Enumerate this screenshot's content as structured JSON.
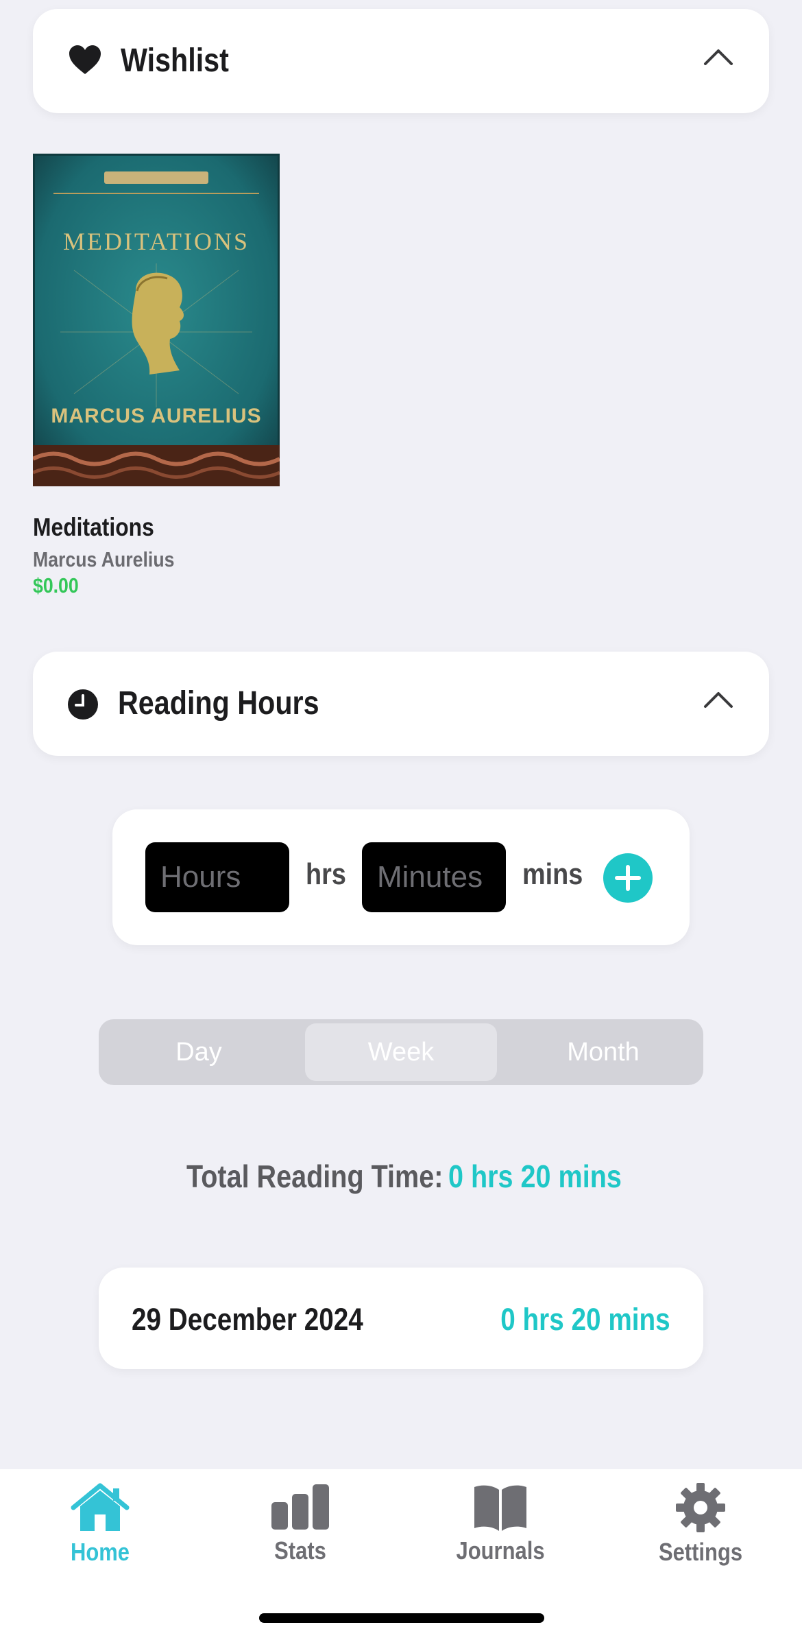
{
  "wishlist": {
    "title": "Wishlist",
    "icon": "heart-icon",
    "book": {
      "title": "Meditations",
      "author": "Marcus Aurelius",
      "price": "$0.00",
      "cover_title": "MEDITATIONS",
      "cover_author": "MARCUS AURELIUS"
    }
  },
  "reading_hours": {
    "title": "Reading Hours",
    "icon": "clock-icon",
    "hours_placeholder": "Hours",
    "hours_unit": "hrs",
    "minutes_placeholder": "Minutes",
    "minutes_unit": "mins",
    "add_icon": "plus-circle-icon"
  },
  "period_selector": {
    "options": [
      "Day",
      "Week",
      "Month"
    ],
    "selected": "Week"
  },
  "total": {
    "label": "Total Reading Time:",
    "value": "0 hrs 20 mins"
  },
  "entries": [
    {
      "date": "29 December 2024",
      "time": "0 hrs 20 mins"
    }
  ],
  "tabbar": {
    "items": [
      {
        "label": "Home",
        "icon": "house-icon",
        "active": true
      },
      {
        "label": "Stats",
        "icon": "bar-chart-icon",
        "active": false
      },
      {
        "label": "Journals",
        "icon": "open-book-icon",
        "active": false
      },
      {
        "label": "Settings",
        "icon": "gear-icon",
        "active": false
      }
    ]
  },
  "colors": {
    "accent": "#1fc7c7",
    "tab_active": "#34c3d6",
    "price_green": "#34c759",
    "background": "#f0f0f6"
  }
}
